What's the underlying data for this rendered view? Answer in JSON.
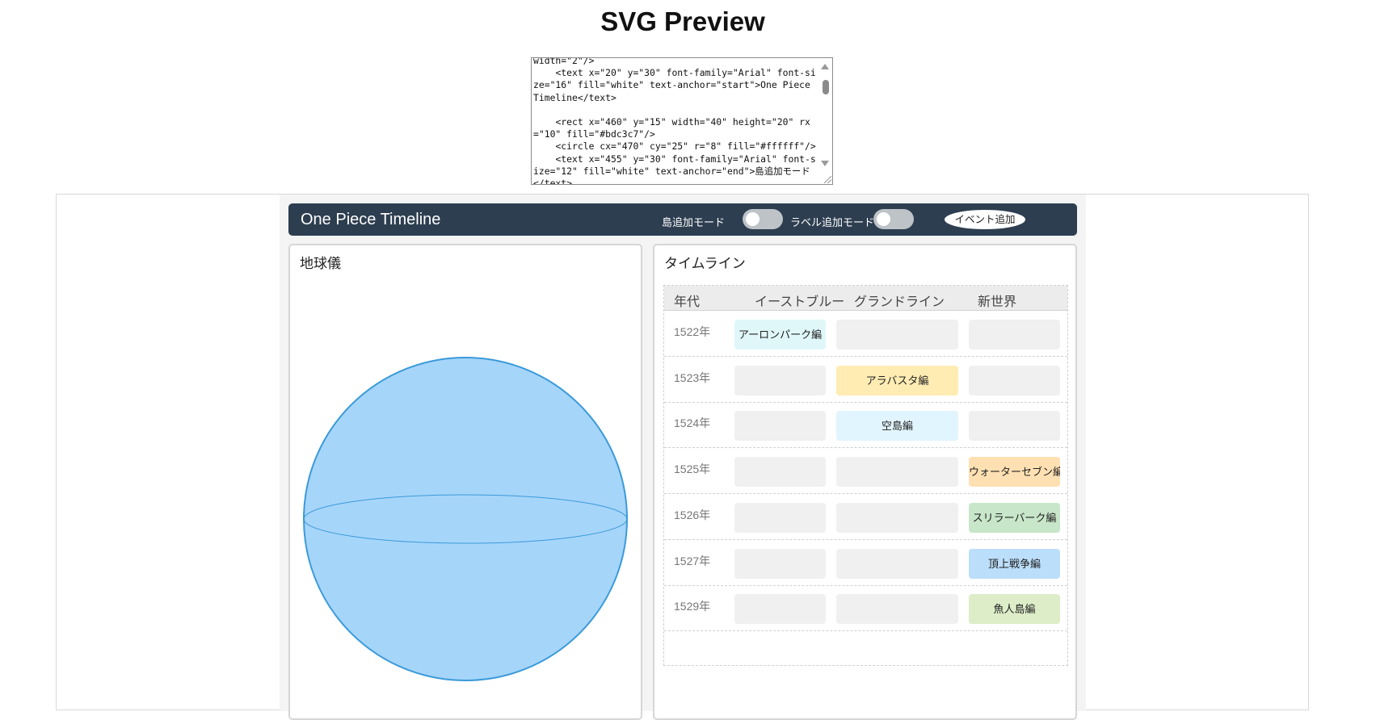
{
  "page": {
    "title": "SVG Preview"
  },
  "code_editor": {
    "content": "width=\"2\"/>\n    <text x=\"20\" y=\"30\" font-family=\"Arial\" font-size=\"16\" fill=\"white\" text-anchor=\"start\">One Piece Timeline</text>\n\n    <rect x=\"460\" y=\"15\" width=\"40\" height=\"20\" rx=\"10\" fill=\"#bdc3c7\"/>\n    <circle cx=\"470\" cy=\"25\" r=\"8\" fill=\"#ffffff\"/>\n    <text x=\"455\" y=\"30\" font-family=\"Arial\" font-size=\"12\" fill=\"white\" text-anchor=\"end\">島追加モード</text>"
  },
  "app": {
    "header": {
      "title": "One Piece Timeline",
      "island_mode_label": "島追加モード",
      "label_mode_label": "ラベル追加モード",
      "add_event_label": "イベント追加"
    },
    "globe_panel": {
      "title": "地球儀"
    },
    "timeline_panel": {
      "title": "タイムライン",
      "columns": [
        "年代",
        "イーストブルー",
        "グランドライン",
        "新世界"
      ],
      "rows": [
        {
          "year": "1522年",
          "east": "アーロンパーク編",
          "grand": "",
          "new": ""
        },
        {
          "year": "1523年",
          "east": "",
          "grand": "アラバスタ編",
          "new": ""
        },
        {
          "year": "1524年",
          "east": "",
          "grand": "空島編",
          "new": ""
        },
        {
          "year": "1525年",
          "east": "",
          "grand": "",
          "new": "ウォーターセブン編"
        },
        {
          "year": "1526年",
          "east": "",
          "grand": "",
          "new": "スリラーバーク編"
        },
        {
          "year": "1527年",
          "east": "",
          "grand": "",
          "new": "頂上戦争編"
        },
        {
          "year": "1529年",
          "east": "",
          "grand": "",
          "new": "魚人島編"
        }
      ]
    }
  },
  "colors": {
    "header_bg": "#2d3e50",
    "toggle_off": "#bdc3c7",
    "globe_fill": "#a6d5fa",
    "globe_stroke": "#3a9ad9",
    "empty_cell": "#f0f0f0",
    "arlong": "#e0f7fa",
    "alabasta": "#ffecb3",
    "skypiea": "#e1f5fe",
    "water7": "#ffe0b2",
    "thriller": "#c8e6c9",
    "marineford": "#bbdefb",
    "fishman": "#dcedc8"
  }
}
